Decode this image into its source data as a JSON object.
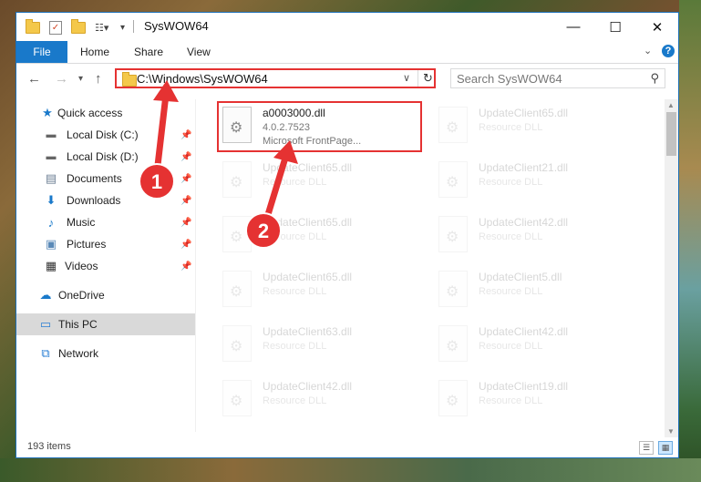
{
  "window": {
    "title": "SysWOW64"
  },
  "ribbon": {
    "file": "File",
    "tabs": [
      "Home",
      "Share",
      "View"
    ]
  },
  "address": {
    "path": "C:\\Windows\\SysWOW64"
  },
  "search": {
    "placeholder": "Search SysWOW64"
  },
  "sidebar": {
    "items": [
      {
        "label": "Quick access",
        "icon": "star-icon",
        "pinned": false
      },
      {
        "label": "Local Disk (C:)",
        "icon": "drive-icon",
        "pinned": true
      },
      {
        "label": "Local Disk (D:)",
        "icon": "drive-icon",
        "pinned": true
      },
      {
        "label": "Documents",
        "icon": "documents-icon",
        "pinned": true
      },
      {
        "label": "Downloads",
        "icon": "download-icon",
        "pinned": true
      },
      {
        "label": "Music",
        "icon": "music-icon",
        "pinned": true
      },
      {
        "label": "Pictures",
        "icon": "pictures-icon",
        "pinned": true
      },
      {
        "label": "Videos",
        "icon": "videos-icon",
        "pinned": true
      },
      {
        "label": "OneDrive",
        "icon": "cloud-icon",
        "pinned": false
      },
      {
        "label": "This PC",
        "icon": "computer-icon",
        "pinned": false,
        "selected": true
      },
      {
        "label": "Network",
        "icon": "network-icon",
        "pinned": false
      }
    ]
  },
  "files": [
    {
      "name": "a0003000.dll",
      "line1": "4.0.2.7523",
      "line2": "Microsoft FrontPage...",
      "highlighted": true
    },
    {
      "name": "UpdateClient65.dll",
      "line1": "Resource DLL"
    },
    {
      "name": "UpdateClient65.dll",
      "line1": "Resource DLL"
    },
    {
      "name": "UpdateClient21.dll",
      "line1": "Resource DLL"
    },
    {
      "name": "UpdateClient65.dll",
      "line1": "Resource DLL"
    },
    {
      "name": "UpdateClient42.dll",
      "line1": "Resource DLL"
    },
    {
      "name": "UpdateClient65.dll",
      "line1": "Resource DLL"
    },
    {
      "name": "UpdateClient5.dll",
      "line1": "Resource DLL"
    },
    {
      "name": "UpdateClient63.dll",
      "line1": "Resource DLL"
    },
    {
      "name": "UpdateClient42.dll",
      "line1": "Resource DLL"
    },
    {
      "name": "UpdateClient42.dll",
      "line1": "Resource DLL"
    },
    {
      "name": "UpdateClient19.dll",
      "line1": "Resource DLL"
    }
  ],
  "status": {
    "count": "193 items"
  },
  "annotations": {
    "step1": "1",
    "step2": "2",
    "color": "#e53232"
  }
}
